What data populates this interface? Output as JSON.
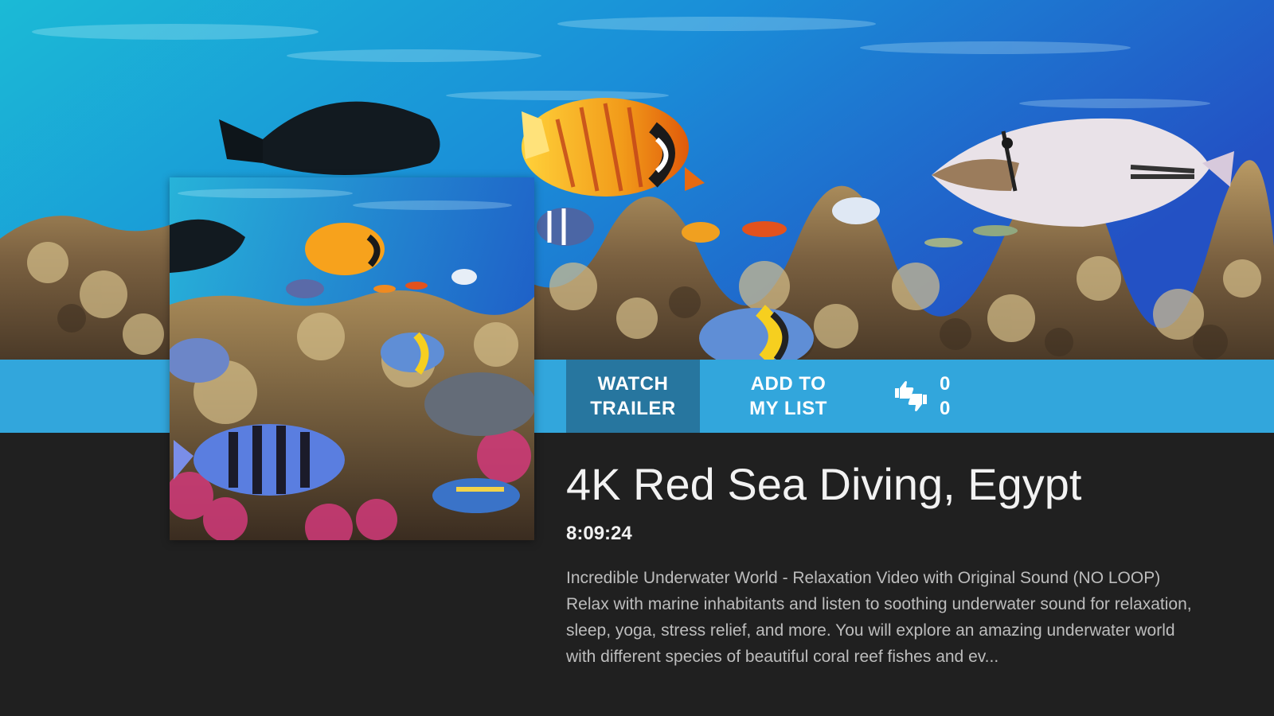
{
  "hero": {
    "backdrop_icon": "underwater-coral-reef-image"
  },
  "poster": {
    "icon": "coral-reef-fish-poster-image"
  },
  "actions": {
    "watch_trailer_line1": "WATCH",
    "watch_trailer_line2": "TRAILER",
    "add_to_list_line1": "ADD TO",
    "add_to_list_line2": "MY LIST",
    "thumbs_icon": "thumbs-up-down-icon",
    "likes": "0",
    "dislikes": "0"
  },
  "details": {
    "title": "4K Red Sea Diving, Egypt",
    "duration": "8:09:24",
    "description_line1": "Incredible Underwater World - Relaxation Video with Original Sound (NO LOOP)",
    "description_line2": "Relax with marine inhabitants and listen to soothing underwater sound for relaxation, sleep, yoga, stress relief, and more. You will explore an amazing underwater world with different species of beautiful coral reef fishes and ev..."
  },
  "colors": {
    "action_bar": "#32a6dc",
    "watch_button": "#27769f",
    "background": "#202020",
    "title_text": "#f2f2f2",
    "description_text": "#bdbdbd"
  }
}
